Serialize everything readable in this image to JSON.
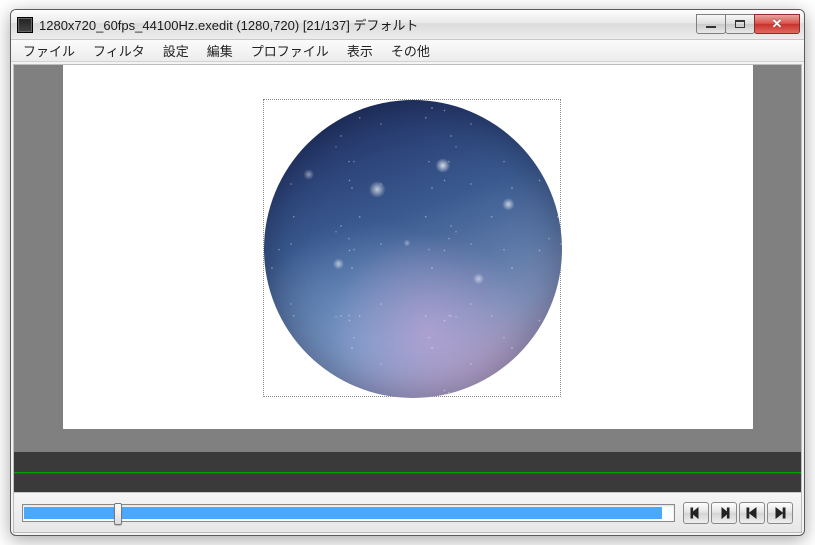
{
  "window": {
    "title": "1280x720_60fps_44100Hz.exedit (1280,720)  [21/137]  デフォルト"
  },
  "menubar": {
    "items": [
      {
        "label": "ファイル"
      },
      {
        "label": "フィルタ"
      },
      {
        "label": "設定"
      },
      {
        "label": "編集"
      },
      {
        "label": "プロファイル"
      },
      {
        "label": "表示"
      },
      {
        "label": "その他"
      }
    ]
  },
  "playback": {
    "current_frame": 21,
    "total_frames": 137,
    "position_percent": 14
  },
  "buttons": {
    "prev_frame": "◀|",
    "next_frame": "|▶",
    "go_start": "|◀",
    "go_end": "▶|"
  }
}
